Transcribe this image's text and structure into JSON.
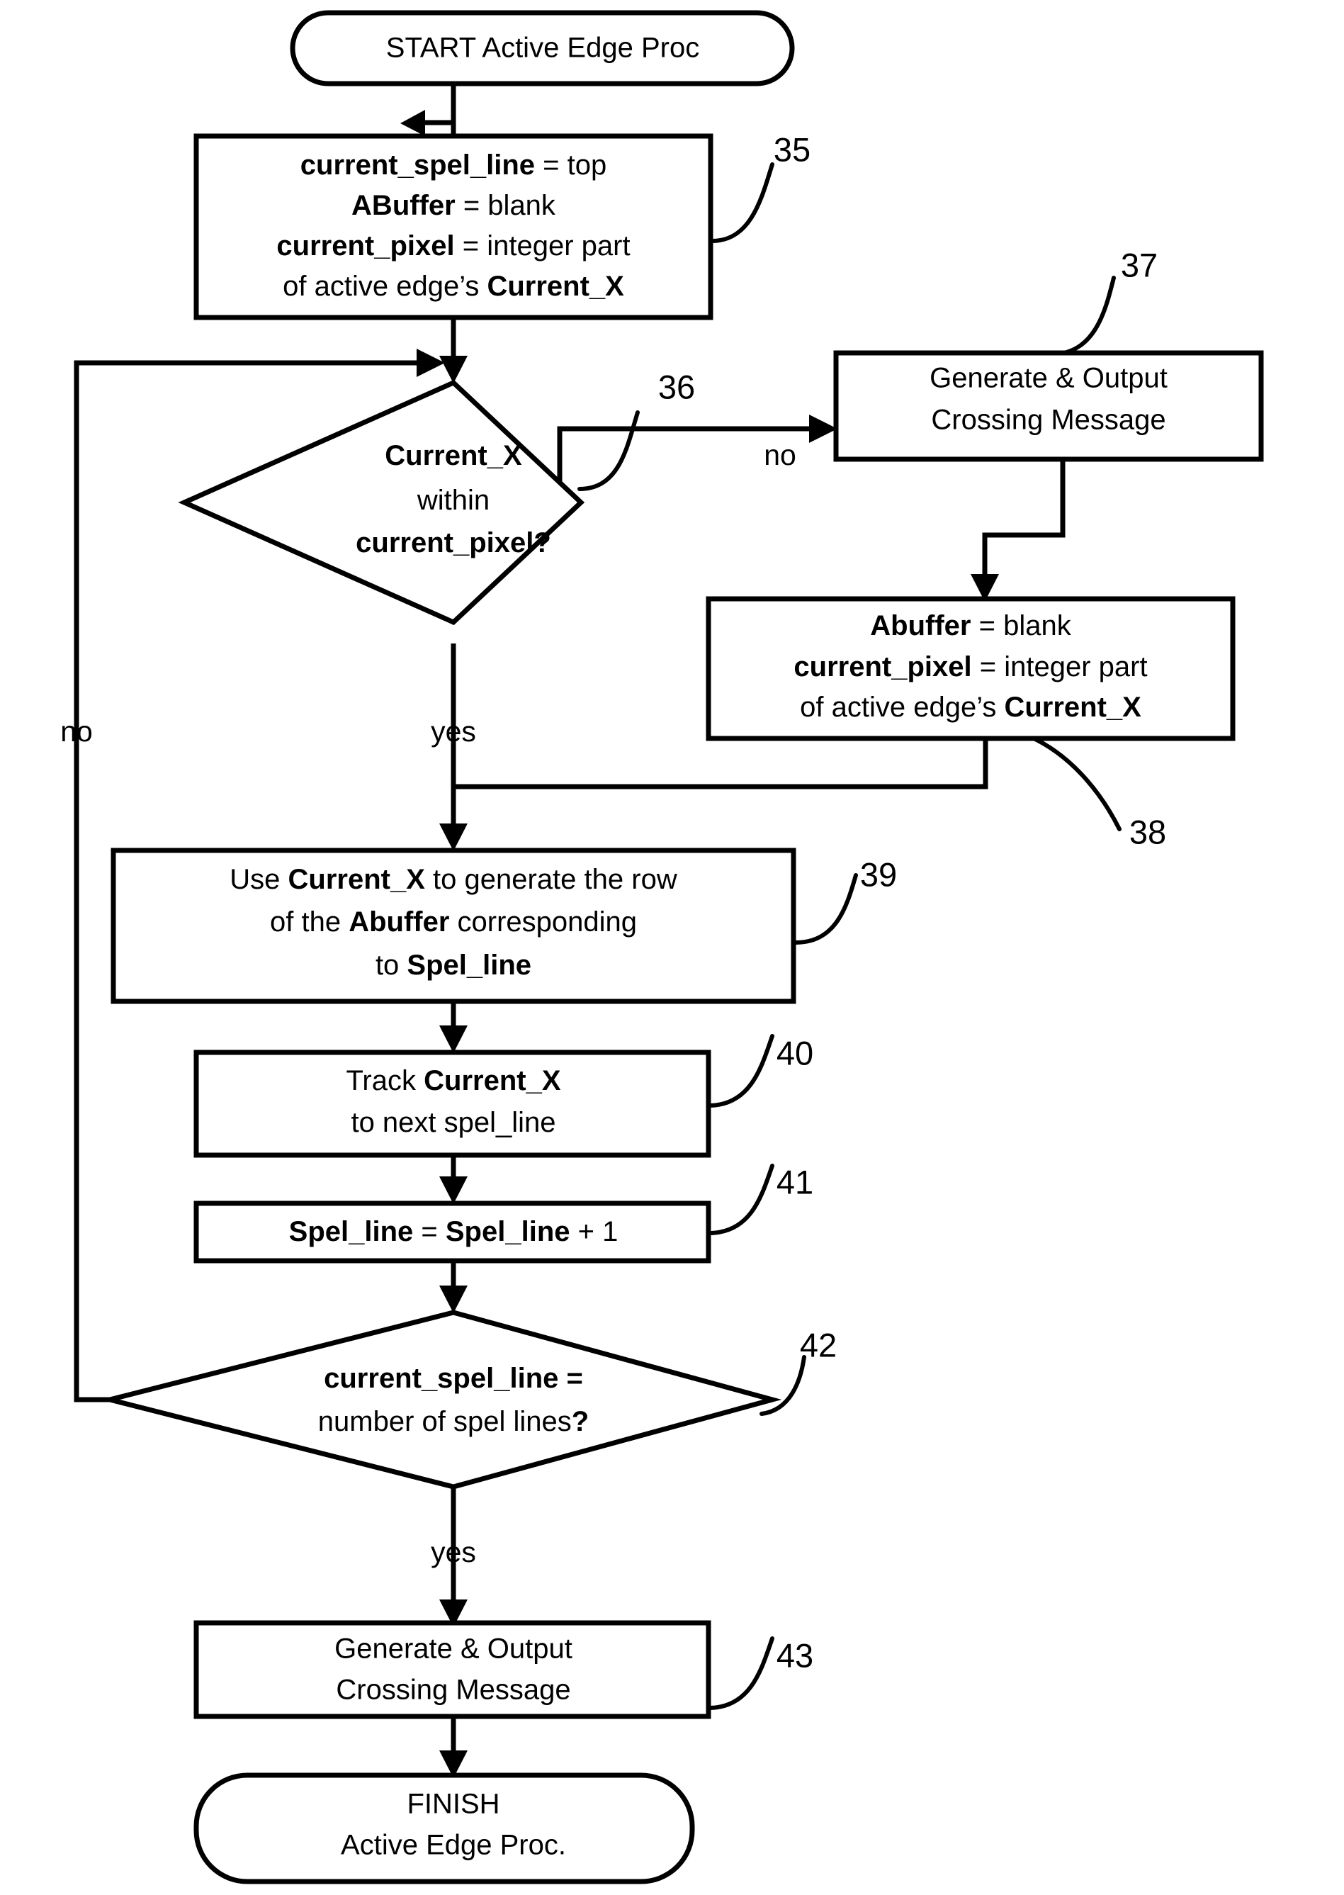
{
  "diagram": {
    "title": "Active Edge Proc flowchart",
    "stroke_color": "#000000",
    "fill_color": "#ffffff"
  },
  "nodes": {
    "start": {
      "shape": "terminator",
      "lines": [
        "START Active Edge Proc"
      ]
    },
    "init_35": {
      "shape": "process",
      "ref": "35",
      "lines": [
        [
          {
            "t": "current_spel_line",
            "b": true
          },
          {
            "t": " = top",
            "b": false
          }
        ],
        [
          {
            "t": "ABuffer",
            "b": true
          },
          {
            "t": " = blank",
            "b": false
          }
        ],
        [
          {
            "t": "current_pixel",
            "b": true
          },
          {
            "t": " = integer part",
            "b": false
          }
        ],
        [
          {
            "t": "of active edge’s ",
            "b": false
          },
          {
            "t": "Current_X",
            "b": true
          }
        ]
      ]
    },
    "decision_36": {
      "shape": "decision",
      "ref": "36",
      "lines": [
        [
          {
            "t": "Current_X",
            "b": true
          }
        ],
        [
          {
            "t": "within",
            "b": false
          }
        ],
        [
          {
            "t": "current_pixel?",
            "b": true
          }
        ]
      ],
      "yes_label": "yes",
      "no_label": "no"
    },
    "crossing_37": {
      "shape": "process",
      "ref": "37",
      "lines": [
        [
          {
            "t": "Generate & Output",
            "b": false
          }
        ],
        [
          {
            "t": "Crossing Message",
            "b": false
          }
        ]
      ]
    },
    "reset_38": {
      "shape": "process",
      "ref": "38",
      "lines": [
        [
          {
            "t": "Abuffer",
            "b": true
          },
          {
            "t": " = blank",
            "b": false
          }
        ],
        [
          {
            "t": "current_pixel",
            "b": true
          },
          {
            "t": " = integer part",
            "b": false
          }
        ],
        [
          {
            "t": "of active edge’s ",
            "b": false
          },
          {
            "t": "Current_X",
            "b": true
          }
        ]
      ]
    },
    "generate_row_39": {
      "shape": "process",
      "ref": "39",
      "lines": [
        [
          {
            "t": "Use ",
            "b": false
          },
          {
            "t": "Current_X",
            "b": true
          },
          {
            "t": " to generate the row",
            "b": false
          }
        ],
        [
          {
            "t": "of the ",
            "b": false
          },
          {
            "t": "Abuffer",
            "b": true
          },
          {
            "t": " corresponding",
            "b": false
          }
        ],
        [
          {
            "t": "to ",
            "b": false
          },
          {
            "t": "Spel_line",
            "b": true
          }
        ]
      ]
    },
    "track_40": {
      "shape": "process",
      "ref": "40",
      "lines": [
        [
          {
            "t": "Track ",
            "b": false
          },
          {
            "t": "Current_X",
            "b": true
          }
        ],
        [
          {
            "t": "to next spel_line",
            "b": false
          }
        ]
      ]
    },
    "increment_41": {
      "shape": "process",
      "ref": "41",
      "lines": [
        [
          {
            "t": "Spel_line",
            "b": true
          },
          {
            "t": " = ",
            "b": false
          },
          {
            "t": "Spel_line",
            "b": true
          },
          {
            "t": " + 1",
            "b": false
          }
        ]
      ]
    },
    "decision_42": {
      "shape": "decision",
      "ref": "42",
      "lines": [
        [
          {
            "t": "current_spel_line =",
            "b": true
          }
        ],
        [
          {
            "t": "number of spel lines",
            "b": false
          },
          {
            "t": "?",
            "b": true
          }
        ]
      ],
      "yes_label": "yes",
      "no_label": "no"
    },
    "crossing_43": {
      "shape": "process",
      "ref": "43",
      "lines": [
        [
          {
            "t": "Generate & Output",
            "b": false
          }
        ],
        [
          {
            "t": "Crossing Message",
            "b": false
          }
        ]
      ]
    },
    "finish": {
      "shape": "terminator",
      "lines": [
        "FINISH",
        "Active Edge Proc."
      ]
    }
  },
  "edge_labels": {
    "d36_no": "no",
    "d36_yes": "yes",
    "d42_no": "no",
    "d42_yes": "yes"
  },
  "ref_numbers": {
    "n35": "35",
    "n36": "36",
    "n37": "37",
    "n38": "38",
    "n39": "39",
    "n40": "40",
    "n41": "41",
    "n42": "42",
    "n43": "43"
  }
}
